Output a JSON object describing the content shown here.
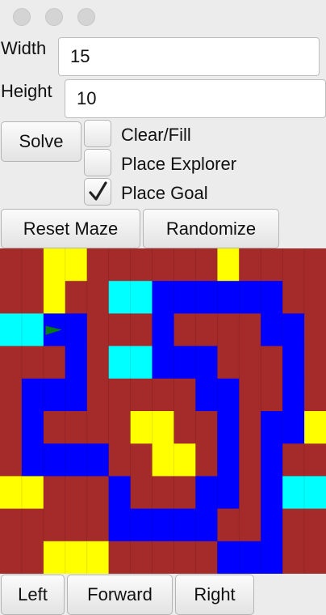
{
  "settings": {
    "width_label": "Width",
    "width_value": "15",
    "height_label": "Height",
    "height_value": "10"
  },
  "controls": {
    "solve_label": "Solve",
    "clear_fill_label": "Clear/Fill",
    "clear_fill_checked": false,
    "place_explorer_label": "Place Explorer",
    "place_explorer_checked": false,
    "place_goal_label": "Place Goal",
    "place_goal_checked": true,
    "reset_label": "Reset Maze",
    "randomize_label": "Randomize"
  },
  "navigation": {
    "left_label": "Left",
    "forward_label": "Forward",
    "right_label": "Right"
  },
  "maze": {
    "columns": 15,
    "rows": 10,
    "legend": {
      "W": "wall",
      "B": "path",
      "Y": "filled",
      "C": "goal"
    },
    "cells": [
      "WWYYWWWWWWYWWWW",
      "WWYWWCCBBBBBBWW",
      "CCBBWWWBWWWWBBW",
      "WWWBWCCBBBWWWBW",
      "WBBBWWWWWBBWWBW",
      "WBWWWWYYWWBWBBY",
      "WBBBBWWYYWBWBWW",
      "YYWWWBWWWBBWBCC",
      "WWWWWBBBBBWWBWW",
      "WWYYYWWWWWBBBWW"
    ],
    "explorer": {
      "row": 2,
      "col": 2,
      "facing": "east"
    },
    "colors": {
      "W": "#a52a2a",
      "B": "#0000ff",
      "Y": "#ffff00",
      "C": "#00ffff",
      "explorer": "#0a7d12"
    }
  }
}
